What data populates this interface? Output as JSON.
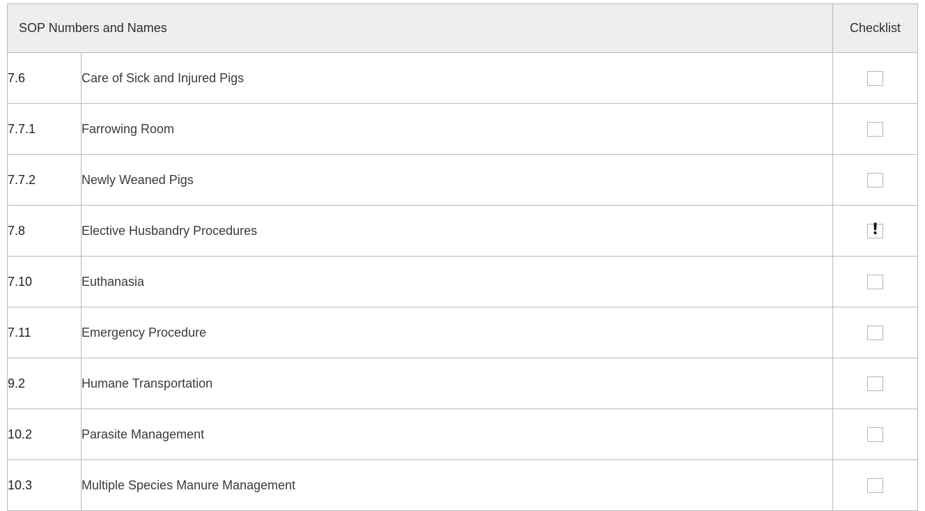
{
  "header": {
    "title": "SOP Numbers and Names",
    "checklist_label": "Checklist"
  },
  "rows": [
    {
      "number": "7.6",
      "name": "Care of Sick and Injured Pigs",
      "checked": false
    },
    {
      "number": "7.7.1",
      "name": "Farrowing Room",
      "checked": false
    },
    {
      "number": "7.7.2",
      "name": "Newly Weaned Pigs",
      "checked": false
    },
    {
      "number": "7.8",
      "name": "Elective Husbandry Procedures",
      "checked": false,
      "mark": "!"
    },
    {
      "number": "7.10",
      "name": "Euthanasia",
      "checked": false
    },
    {
      "number": "7.11",
      "name": "Emergency Procedure",
      "checked": false
    },
    {
      "number": "9.2",
      "name": "Humane Transportation",
      "checked": false
    },
    {
      "number": "10.2",
      "name": "Parasite Management",
      "checked": false
    },
    {
      "number": "10.3",
      "name": "Multiple Species Manure Management",
      "checked": false
    }
  ],
  "colors": {
    "header_background": "#eeeeee",
    "border": "#b9b9b9",
    "checkbox_border": "#b3b3b3"
  }
}
